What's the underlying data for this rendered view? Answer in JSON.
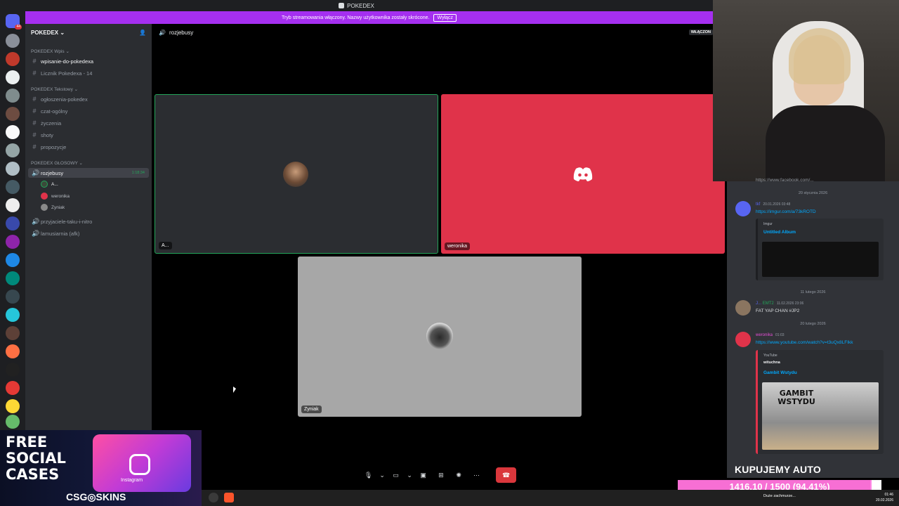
{
  "window": {
    "title": "POKEDEX"
  },
  "banner": {
    "text": "Tryb streamowania włączony. Nazwy użytkownika zostały skrócone.",
    "button": "Wyłącz"
  },
  "server": {
    "name": "POKEDEX"
  },
  "categories": [
    {
      "label": "POKEDEX Wpis"
    },
    {
      "label": "POKEDEX Tekstowy"
    },
    {
      "label": "POKEDEX GŁOSOWY"
    }
  ],
  "text_channels_wpis": [
    {
      "name": "wpisanie-do-pokedexa"
    },
    {
      "name": "Licznik Pokedexa - 14"
    }
  ],
  "text_channels": [
    {
      "name": "ogłoszenia-pokedex"
    },
    {
      "name": "czat-ogólny"
    },
    {
      "name": "życzenia"
    },
    {
      "name": "shoty"
    },
    {
      "name": "propozycje"
    }
  ],
  "voice_channels": [
    {
      "name": "rozjebusy",
      "timer": "1:18:34"
    },
    {
      "name": "przyjaciele-taku-i-nitro"
    },
    {
      "name": "lamusiarnia (afk)"
    }
  ],
  "voice_users": [
    {
      "name": "A..."
    },
    {
      "name": "weronika"
    },
    {
      "name": "Zyniak"
    }
  ],
  "voice_header": {
    "channel": "rozjebusy",
    "live_label": "WŁĄCZON"
  },
  "tiles": [
    {
      "name": "A..."
    },
    {
      "name": "weronika"
    },
    {
      "name": "Zyniak"
    }
  ],
  "chat": {
    "top_text": "https://www.facebook.com/...",
    "dates": [
      "20 stycznia 2026",
      "11 lutego 2026",
      "20 lutego 2026"
    ],
    "messages": [
      {
        "author": "tkf",
        "timestamp": "20.01.2026 03:48",
        "link": "https://imgur.com/a/73kROTD",
        "embed_provider": "Imgur",
        "embed_title": "Untitled Album"
      },
      {
        "author": "J...",
        "badge": "EMT2",
        "timestamp": "11.02.2026 23:06",
        "text": "FAT YAP CHAN #JP2"
      },
      {
        "author": "weronika",
        "timestamp": "01:03",
        "link": "https://www.youtube.com/watch?v=t3uQx8LFIkk",
        "embed_provider": "YouTube",
        "embed_author": "wituchna",
        "embed_title": "Gambit Wstydu",
        "thumb_text": "GAMBIT WSTYDU"
      }
    ]
  },
  "overlay": {
    "headline": "KUPUJEMY AUTO",
    "progress_text": "1416.10 / 1500 (94.41%)",
    "progress_fraction": 0.9441
  },
  "ad": {
    "line1": "FREE",
    "line2": "SOCIAL",
    "line3": "CASES",
    "brand": "CSG◎SKINS",
    "tag": "Instagram"
  },
  "taskbar": {
    "weather": "Duże zachmurze...",
    "time": "01:46",
    "date": "20.02.2026"
  },
  "colors": {
    "banner": "#a52ff0",
    "discord_red": "#e0334a",
    "tile_gray": "#a7a7a7",
    "tile_dark": "#2b2d31",
    "speaking_green": "#23a55a",
    "progress_pink": "#ff8ae6"
  }
}
